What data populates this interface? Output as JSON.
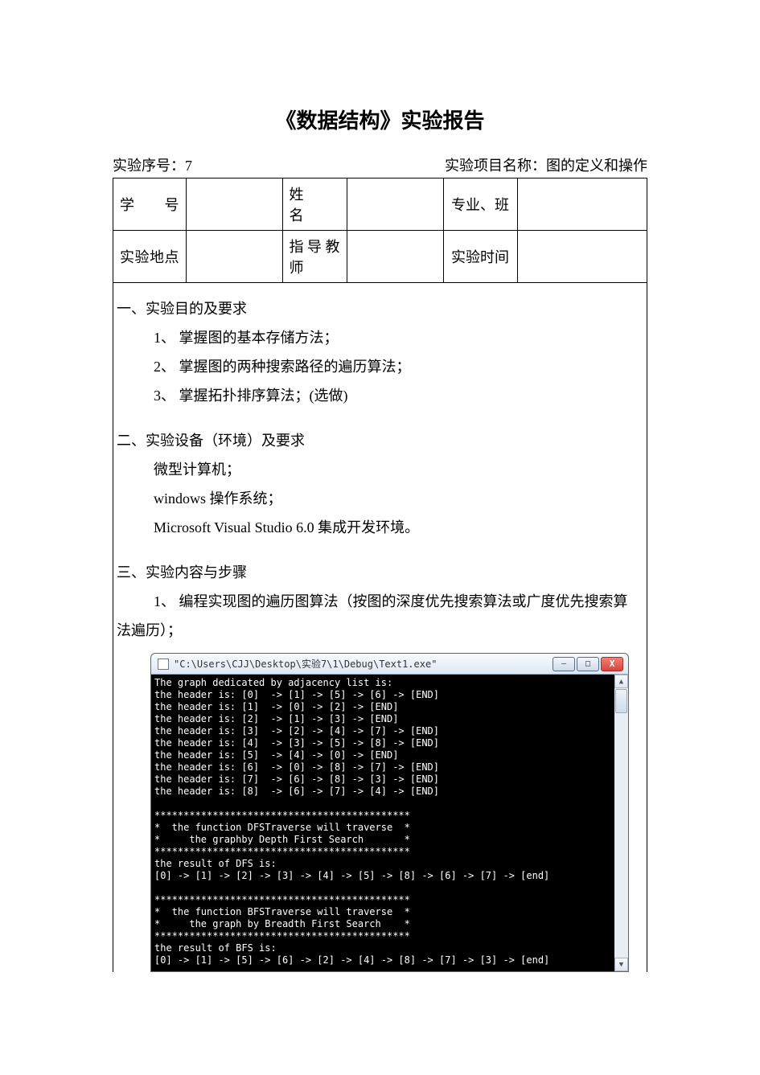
{
  "title": "《数据结构》实验报告",
  "meta": {
    "seq_label": "实验序号：",
    "seq_value": "7",
    "proj_label": "实验项目名称：",
    "proj_value": "图的定义和操作"
  },
  "info_table": {
    "r1c1": "学　　号",
    "r1c3": "姓　　名",
    "r1c5": "专业、班",
    "r2c1": "实验地点",
    "r2c3": "指导教师",
    "r2c5": "实验时间"
  },
  "sections": {
    "s1_head": "一、实验目的及要求",
    "s1_items": [
      "1、 掌握图的基本存储方法；",
      "2、 掌握图的两种搜索路径的遍历算法；",
      "3、 掌握拓扑排序算法；(选做)"
    ],
    "s2_head": "二、实验设备（环境）及要求",
    "s2_lines": [
      "微型计算机；",
      "windows 操作系统；",
      "Microsoft Visual Studio 6.0 集成开发环境。"
    ],
    "s3_head": "三、实验内容与步骤",
    "s3_line": "1、 编程实现图的遍历图算法（按图的深度优先搜索算法或广度优先搜索算",
    "s3_line2": "法遍历）；"
  },
  "console": {
    "title": "\"C:\\Users\\CJJ\\Desktop\\实验7\\1\\Debug\\Text1.exe\"",
    "min_glyph": "–",
    "max_glyph": "□",
    "close_glyph": "X",
    "up_glyph": "▲",
    "down_glyph": "▼",
    "body": "The graph dedicated by adjacency list is:\nthe header is: [0]  -> [1] -> [5] -> [6] -> [END]\nthe header is: [1]  -> [0] -> [2] -> [END]\nthe header is: [2]  -> [1] -> [3] -> [END]\nthe header is: [3]  -> [2] -> [4] -> [7] -> [END]\nthe header is: [4]  -> [3] -> [5] -> [8] -> [END]\nthe header is: [5]  -> [4] -> [0] -> [END]\nthe header is: [6]  -> [0] -> [8] -> [7] -> [END]\nthe header is: [7]  -> [6] -> [8] -> [3] -> [END]\nthe header is: [8]  -> [6] -> [7] -> [4] -> [END]\n\n********************************************\n*  the function DFSTraverse will traverse  *\n*     the graphby Depth First Search       *\n********************************************\nthe result of DFS is:\n[0] -> [1] -> [2] -> [3] -> [4] -> [5] -> [8] -> [6] -> [7] -> [end]\n\n********************************************\n*  the function BFSTraverse will traverse  *\n*     the graph by Breadth First Search    *\n********************************************\nthe result of BFS is:\n[0] -> [1] -> [5] -> [6] -> [2] -> [4] -> [8] -> [7] -> [3] -> [end]"
  }
}
